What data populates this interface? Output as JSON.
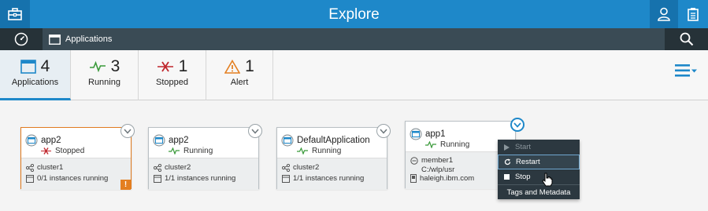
{
  "header": {
    "title": "Explore"
  },
  "subnav": {
    "breadcrumb": "Applications"
  },
  "summary": {
    "applications": {
      "count": "4",
      "label": "Applications"
    },
    "running": {
      "count": "3",
      "label": "Running"
    },
    "stopped": {
      "count": "1",
      "label": "Stopped"
    },
    "alert": {
      "count": "1",
      "label": "Alert"
    }
  },
  "cards": [
    {
      "name": "app2",
      "status": "Stopped",
      "line1": "cluster1",
      "line2": "0/1 instances running",
      "alert": "!"
    },
    {
      "name": "app2",
      "status": "Running",
      "line1": "cluster2",
      "line2": "1/1 instances running"
    },
    {
      "name": "DefaultApplication",
      "status": "Running",
      "line1": "cluster2",
      "line2": "1/1 instances running"
    },
    {
      "name": "app1",
      "status": "Running",
      "line1": "member1",
      "line1b": "C:/wlp/usr",
      "line2": "haleigh.ibm.com"
    }
  ],
  "menu": {
    "start": "Start",
    "restart": "Restart",
    "stop": "Stop",
    "tags": "Tags and Metadata"
  },
  "colors": {
    "brand_blue": "#1e88c9",
    "dark_bar": "#3a4b55",
    "running_green": "#3a9a3a",
    "stopped_red": "#c0262d",
    "alert_orange": "#e47f20"
  }
}
